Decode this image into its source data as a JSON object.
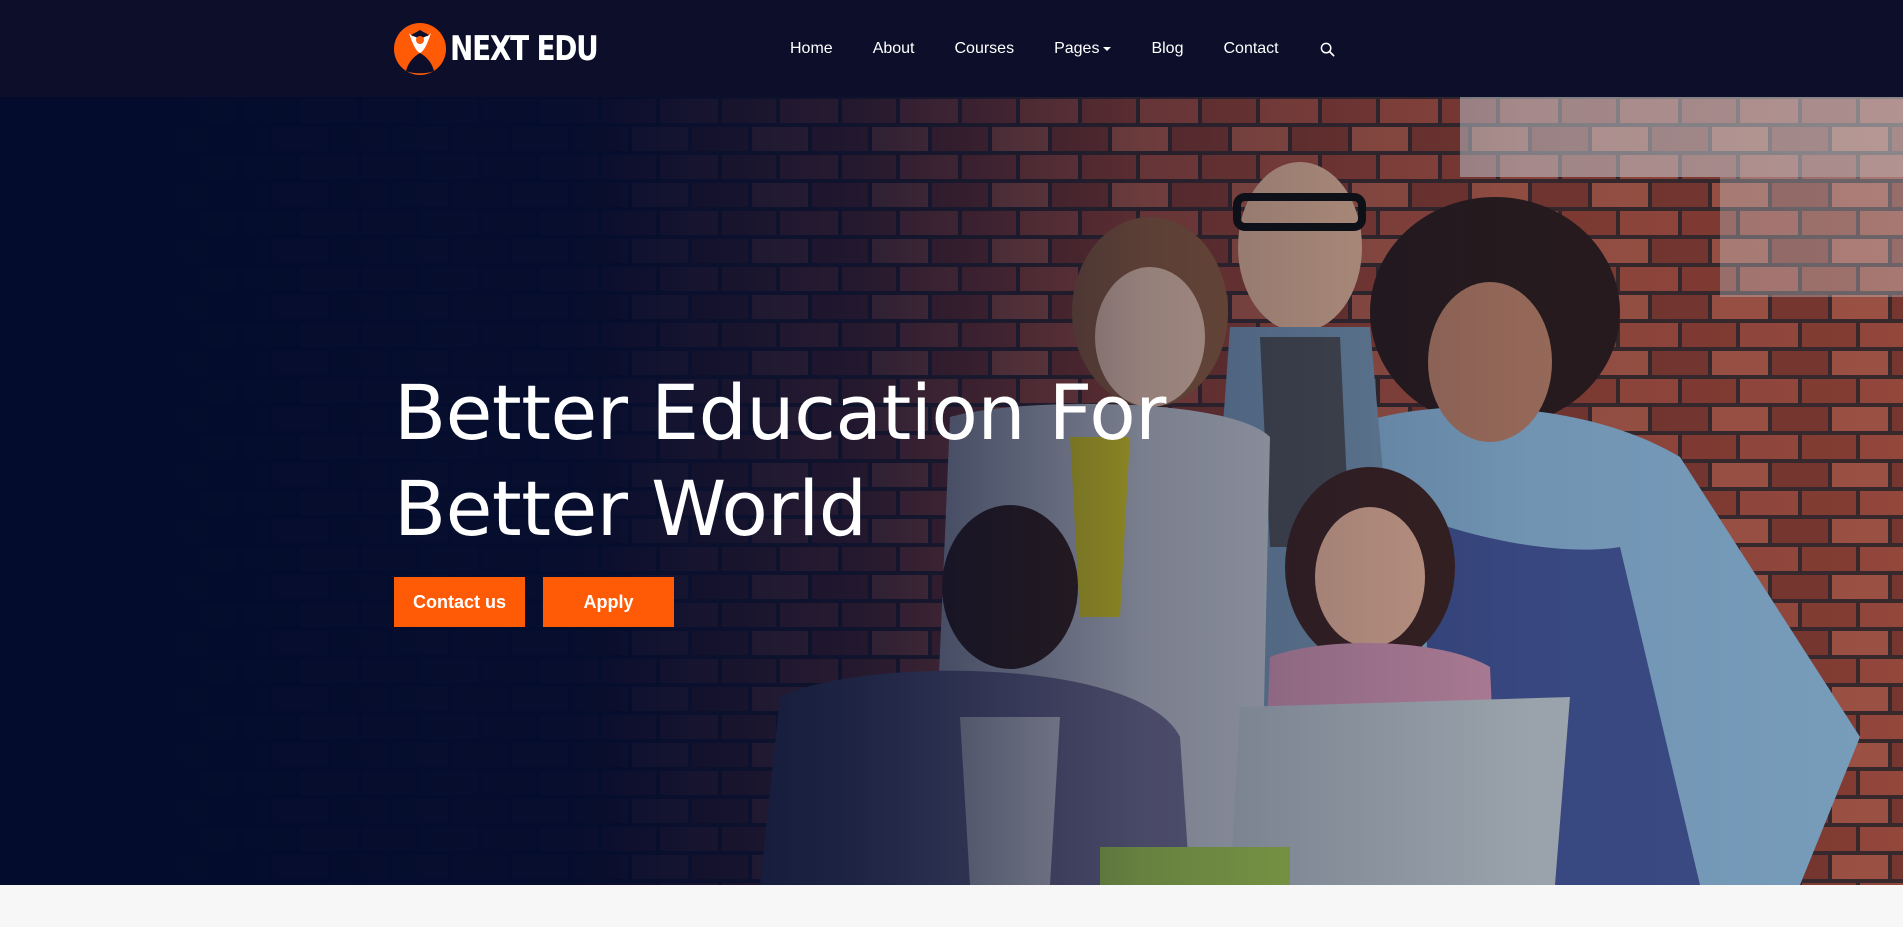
{
  "brand": {
    "name": "NEXT EDU",
    "accent_color": "#ff5a06",
    "nav_background": "#0c0e2a"
  },
  "nav": {
    "items": [
      {
        "label": "Home"
      },
      {
        "label": "About"
      },
      {
        "label": "Courses"
      },
      {
        "label": "Pages",
        "has_dropdown": true
      },
      {
        "label": "Blog"
      },
      {
        "label": "Contact"
      }
    ],
    "search_icon": "search-icon"
  },
  "hero": {
    "title_line1": "Better Education For",
    "title_line2": "Better World",
    "primary_button": "Contact us",
    "secondary_button": "Apply",
    "overlay_color": "#030c2d"
  }
}
